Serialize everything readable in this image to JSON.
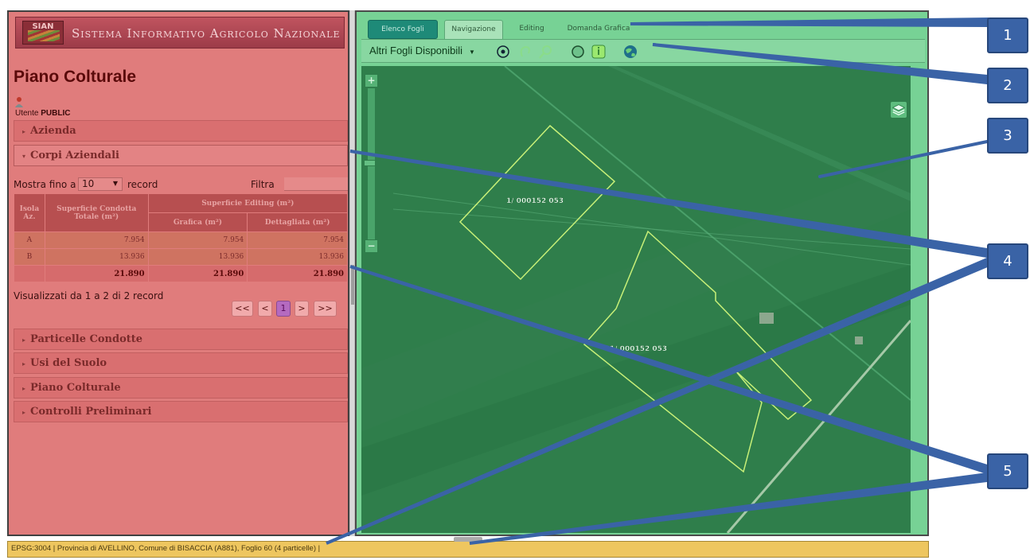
{
  "left_panel": {
    "logo_text": "SIAN",
    "system_title": "Sistema Informativo Agricolo Nazionale",
    "page_title": "Piano Colturale",
    "user_prefix": "Utente",
    "user_name": "PUBLIC",
    "accordion": [
      {
        "label": "Azienda",
        "open": false
      },
      {
        "label": "Corpi Aziendali",
        "open": true
      },
      {
        "label": "Particelle Condotte",
        "open": false
      },
      {
        "label": "Usi del Suolo",
        "open": false
      },
      {
        "label": "Piano Colturale",
        "open": false
      },
      {
        "label": "Controlli Preliminari",
        "open": false
      }
    ],
    "table_controls": {
      "show_prefix": "Mostra fino a",
      "page_size": "10",
      "record_label": "record",
      "filter_label": "Filtra",
      "filter_value": ""
    },
    "table": {
      "headers": {
        "isola": "Isola Az.",
        "superficie_condotta": "Superficie Condotta Totale (m²)",
        "superficie_editing": "Superficie Editing (m²)",
        "grafica": "Grafica (m²)",
        "dettagliata": "Dettagliata (m²)"
      },
      "rows": [
        {
          "isola": "A",
          "condotta": "7.954",
          "grafica": "7.954",
          "dettagliata": "7.954"
        },
        {
          "isola": "B",
          "condotta": "13.936",
          "grafica": "13.936",
          "dettagliata": "13.936"
        }
      ],
      "totals": {
        "condotta": "21.890",
        "grafica": "21.890",
        "dettagliata": "21.890"
      }
    },
    "records_info": "Visualizzati da 1 a 2 di 2 record",
    "pager": {
      "first": "<<",
      "prev": "<",
      "current": "1",
      "next": ">",
      "last": ">>"
    }
  },
  "right_panel": {
    "tabs": [
      {
        "label": "Elenco Fogli",
        "style": "primary"
      },
      {
        "label": "Navigazione",
        "style": "selected"
      },
      {
        "label": "Editing",
        "style": "normal"
      },
      {
        "label": "Domanda Grafica",
        "style": "normal"
      }
    ],
    "sheet_select": "Altri Fogli Disponibili",
    "tools": [
      "pan-icon",
      "lasso-icon",
      "zoom-search-icon",
      "circle-icon",
      "info-icon",
      "globe-icon"
    ],
    "map": {
      "parcels": [
        {
          "label": "1/ 000152 053"
        },
        {
          "label": "1/ 000152 053"
        }
      ],
      "zoom_in": "+",
      "zoom_out": "−"
    }
  },
  "status_bar": {
    "text": "EPSG:3004  |  Provincia di AVELLINO, Comune di BISACCIA (A881), Foglio 60 (4 particelle)  |"
  },
  "callouts": [
    "1",
    "2",
    "3",
    "4",
    "5"
  ],
  "colors": {
    "left_panel": "#e07c7c",
    "right_panel": "#77d295",
    "status_bar": "#eec65f",
    "callout": "#3a63a6",
    "parcel_outline": "#c8f078"
  }
}
